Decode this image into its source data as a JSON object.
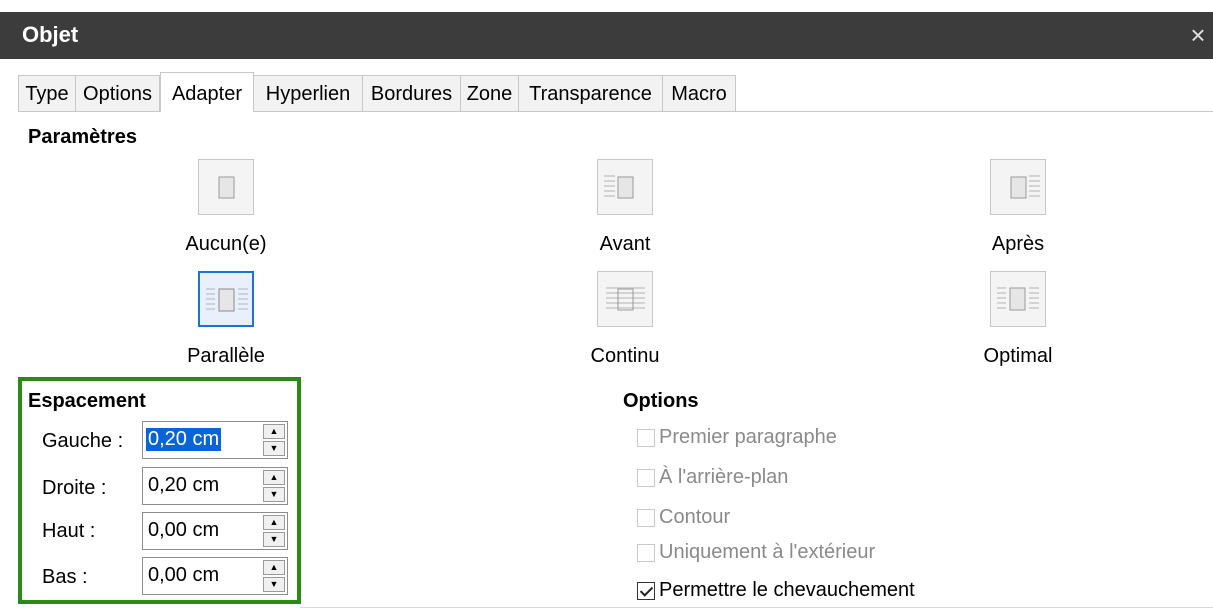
{
  "window": {
    "title": "Objet",
    "close_icon": "×"
  },
  "tabs": [
    {
      "label": "Type"
    },
    {
      "label": "Options"
    },
    {
      "label": "Adapter",
      "active": true
    },
    {
      "label": "Hyperlien"
    },
    {
      "label": "Bordures"
    },
    {
      "label": "Zone"
    },
    {
      "label": "Transparence"
    },
    {
      "label": "Macro"
    }
  ],
  "parametres": {
    "title": "Paramètres",
    "wrap_options": [
      {
        "label": "Aucun(e)",
        "icon": "wrap-none-icon"
      },
      {
        "label": "Avant",
        "icon": "wrap-before-icon"
      },
      {
        "label": "Après",
        "icon": "wrap-after-icon"
      },
      {
        "label": "Parallèle",
        "icon": "wrap-parallel-icon",
        "selected": true
      },
      {
        "label": "Continu",
        "icon": "wrap-through-icon"
      },
      {
        "label": "Optimal",
        "icon": "wrap-optimal-icon"
      }
    ]
  },
  "espacement": {
    "title": "Espacement",
    "fields": [
      {
        "label": "Gauche :",
        "value": "0,20 cm",
        "selected": true
      },
      {
        "label": "Droite :",
        "value": "0,20 cm"
      },
      {
        "label": "Haut :",
        "value": "0,00 cm"
      },
      {
        "label": "Bas :",
        "value": "0,00 cm"
      }
    ]
  },
  "options": {
    "title": "Options",
    "items": [
      {
        "label": "Premier paragraphe",
        "checked": false,
        "enabled": false
      },
      {
        "label": "À l'arrière-plan",
        "checked": false,
        "enabled": false
      },
      {
        "label": "Contour",
        "checked": false,
        "enabled": false
      },
      {
        "label": "Uniquement à l'extérieur",
        "checked": false,
        "enabled": false
      },
      {
        "label": "Permettre le chevauchement",
        "checked": true,
        "enabled": true
      }
    ]
  },
  "colors": {
    "highlight_frame": "#2a8a14",
    "selection": "#0a64d8",
    "titlebar": "#3c3c3c"
  }
}
